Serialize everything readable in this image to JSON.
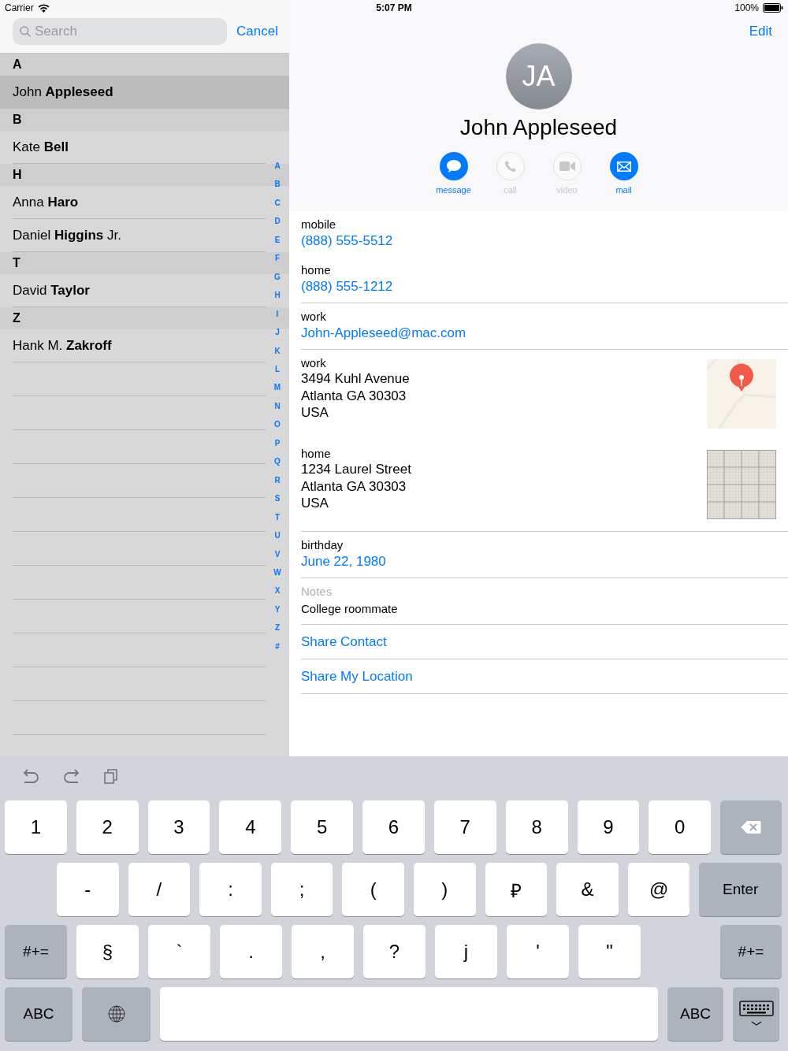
{
  "status_bar": {
    "carrier": "Carrier",
    "time": "5:07 PM",
    "battery": "100%"
  },
  "search": {
    "placeholder": "Search",
    "cancel": "Cancel"
  },
  "sections": [
    {
      "letter": "A",
      "contacts": [
        {
          "name": "John **Appleseed**",
          "selected": true
        }
      ]
    },
    {
      "letter": "B",
      "contacts": [
        {
          "name": "Kate **Bell**",
          "selected": false
        }
      ]
    },
    {
      "letter": "H",
      "contacts": [
        {
          "name": "Anna **Haro**",
          "selected": false
        },
        {
          "name": "Daniel **Higgins** Jr.",
          "selected": false
        }
      ]
    },
    {
      "letter": "T",
      "contacts": [
        {
          "name": "David **Taylor**",
          "selected": false
        }
      ]
    },
    {
      "letter": "Z",
      "contacts": [
        {
          "name": "Hank M. **Zakroff**",
          "selected": false
        }
      ]
    }
  ],
  "index": [
    "A",
    "B",
    "C",
    "D",
    "E",
    "F",
    "G",
    "H",
    "I",
    "J",
    "K",
    "L",
    "M",
    "N",
    "O",
    "P",
    "Q",
    "R",
    "S",
    "T",
    "U",
    "V",
    "W",
    "X",
    "Y",
    "Z",
    "#"
  ],
  "detail": {
    "edit": "Edit",
    "initials": "JA",
    "name": "John Appleseed",
    "actions": [
      {
        "kind": "message",
        "label": "message",
        "enabled": true
      },
      {
        "kind": "call",
        "label": "call",
        "enabled": false
      },
      {
        "kind": "video",
        "label": "video",
        "enabled": false
      },
      {
        "kind": "mail",
        "label": "mail",
        "enabled": true
      }
    ],
    "sections": [
      {
        "fields": [
          {
            "kind": "link",
            "label": "mobile",
            "value": "(888) 555-5512"
          },
          {
            "kind": "link",
            "label": "home",
            "value": "(888) 555-1212"
          }
        ]
      },
      {
        "fields": [
          {
            "kind": "link",
            "label": "work",
            "value": "John-Appleseed@mac.com"
          }
        ]
      },
      {
        "fields": [
          {
            "kind": "address",
            "label": "work",
            "lines": [
              "3494 Kuhl Avenue",
              "Atlanta GA 30303",
              "USA"
            ],
            "thumbnail": {
              "kind": "picture"
            }
          },
          {
            "kind": "address",
            "label": "home",
            "lines": [
              "1234 Laurel Street",
              "Atlanta GA 30303",
              "USA"
            ],
            "thumbnail": {
              "kind": "picture"
            }
          }
        ]
      },
      {
        "fields": [
          {
            "kind": "link",
            "label": "birthday",
            "value": "June 22, 1980"
          }
        ]
      },
      {
        "fields": [
          {
            "kind": "note",
            "label": "Notes",
            "value": "College roommate"
          }
        ]
      },
      {
        "fields": [
          {
            "kind": "action",
            "value": "Share Contact"
          }
        ]
      },
      {
        "fields": [
          {
            "kind": "action",
            "value": "Share My Location"
          }
        ]
      }
    ]
  },
  "keyboard": {
    "rows": [
      [
        {
          "kind": "char",
          "label": "1"
        },
        {
          "kind": "char",
          "label": "2"
        },
        {
          "kind": "char",
          "label": "3"
        },
        {
          "kind": "char",
          "label": "4"
        },
        {
          "kind": "char",
          "label": "5"
        },
        {
          "kind": "char",
          "label": "6"
        },
        {
          "kind": "char",
          "label": "7"
        },
        {
          "kind": "char",
          "label": "8"
        },
        {
          "kind": "char",
          "label": "9"
        },
        {
          "kind": "char",
          "label": "0"
        },
        {
          "kind": "delete"
        }
      ],
      [
        {
          "kind": "char",
          "label": "-"
        },
        {
          "kind": "char",
          "label": "/"
        },
        {
          "kind": "char",
          "label": ":"
        },
        {
          "kind": "char",
          "label": ";"
        },
        {
          "kind": "char",
          "label": "("
        },
        {
          "kind": "char",
          "label": ")"
        },
        {
          "kind": "char",
          "label": "₽"
        },
        {
          "kind": "char",
          "label": "&"
        },
        {
          "kind": "char",
          "label": "@"
        },
        {
          "kind": "function",
          "label": "Enter"
        }
      ],
      [
        {
          "kind": "function",
          "label": "#+="
        },
        {
          "kind": "char",
          "label": "§"
        },
        {
          "kind": "char",
          "label": "`"
        },
        {
          "kind": "char",
          "label": "."
        },
        {
          "kind": "char",
          "label": ","
        },
        {
          "kind": "char",
          "label": "?"
        },
        {
          "kind": "char",
          "label": "j"
        },
        {
          "kind": "char",
          "label": "'"
        },
        {
          "kind": "char",
          "label": "\""
        },
        {
          "kind": "function",
          "label": "#+="
        }
      ],
      [
        {
          "kind": "function",
          "label": "ABC"
        },
        {
          "kind": "globe"
        },
        {
          "kind": "space"
        },
        {
          "kind": "function",
          "label": "ABC"
        },
        {
          "kind": "dismiss"
        }
      ]
    ]
  }
}
